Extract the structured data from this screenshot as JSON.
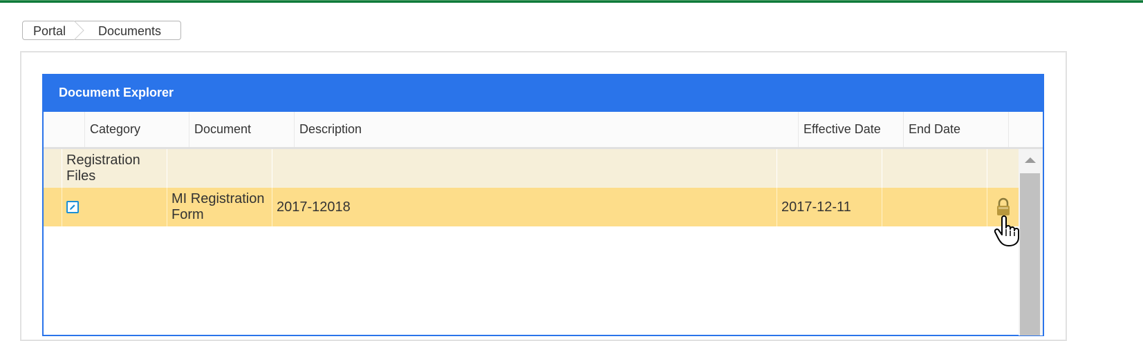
{
  "breadcrumb": {
    "items": [
      {
        "label": "Portal"
      },
      {
        "label": "Documents"
      }
    ]
  },
  "explorer": {
    "title": "Document Explorer",
    "columns": [
      "Category",
      "Document",
      "Description",
      "Effective Date",
      "End Date"
    ],
    "group_row": {
      "label": "Registration Files"
    },
    "doc_row": {
      "document": "MI Registration Form",
      "description": "2017-12018",
      "effective_date": "2017-12-11",
      "end_date": "",
      "icons": [
        "edit-icon",
        "lock-icon"
      ]
    }
  },
  "colors": {
    "accent": "#2a74ea",
    "group_row_bg": "#f6efd9",
    "selected_row_bg": "#fddd8a",
    "topbar": "#0f7a3a"
  }
}
